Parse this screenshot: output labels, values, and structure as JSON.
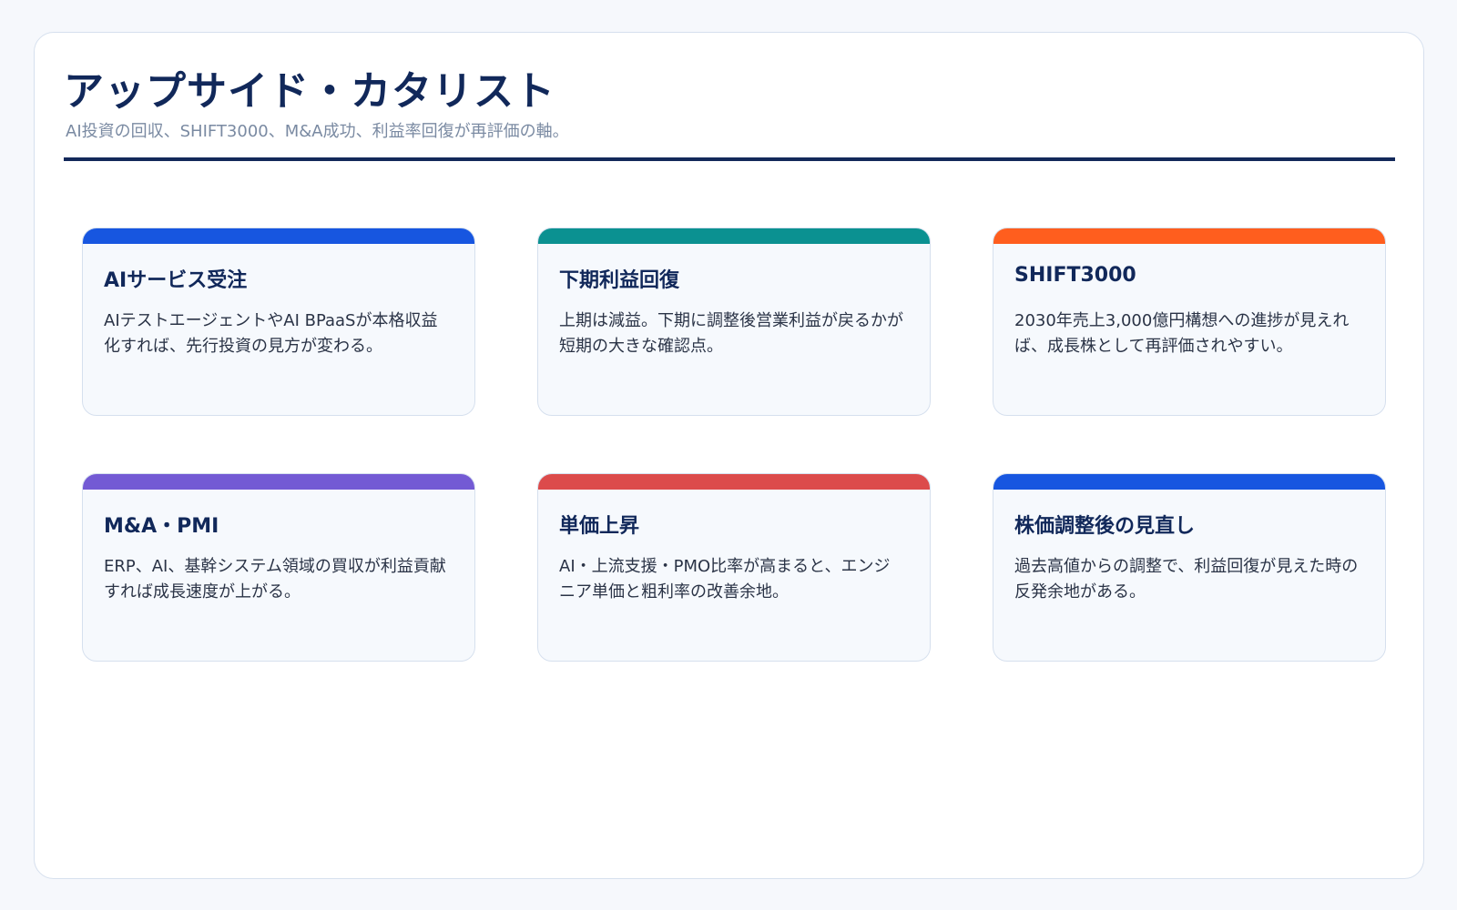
{
  "header": {
    "title": "アップサイド・カタリスト",
    "subtitle": "AI投資の回収、SHIFT3000、M&A成功、利益率回復が再評価の軸。"
  },
  "cards": [
    {
      "title": "AIサービス受注",
      "body": "AIテストエージェントやAI BPaaSが本格収益化すれば、先行投資の見方が変わる。",
      "accent": "#1756e0"
    },
    {
      "title": "下期利益回復",
      "body": "上期は減益。下期に調整後営業利益が戻るかが短期の大きな確認点。",
      "accent": "#0b9191"
    },
    {
      "title": "SHIFT3000",
      "body": "2030年売上3,000億円構想への進捗が見えれば、成長株として再評価されやすい。",
      "accent": "#ff5e1e"
    },
    {
      "title": "M&A・PMI",
      "body": "ERP、AI、基幹システム領域の買収が利益貢献すれば成長速度が上がる。",
      "accent": "#735ad4"
    },
    {
      "title": "単価上昇",
      "body": "AI・上流支援・PMO比率が高まると、エンジニア単価と粗利率の改善余地。",
      "accent": "#dc4b4b"
    },
    {
      "title": "株価調整後の見直し",
      "body": "過去高値からの調整で、利益回復が見えた時の反発余地がある。",
      "accent": "#1756e0"
    }
  ]
}
